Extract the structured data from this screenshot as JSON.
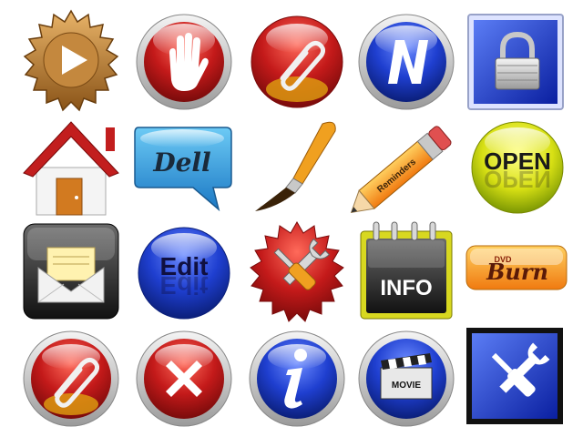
{
  "icons": [
    {
      "name": "play-icon",
      "color": "#b8782e"
    },
    {
      "name": "stop-hand-icon",
      "color": "#c41a1a"
    },
    {
      "name": "paperclip-icon",
      "color": "#c41a1a"
    },
    {
      "name": "n-letter-icon",
      "color": "#1f3fd0"
    },
    {
      "name": "padlock-icon",
      "color": "#1f3fd0"
    },
    {
      "name": "home-icon",
      "color": "#c21e1e"
    },
    {
      "name": "dell-speech-bubble-icon",
      "label": "Dell",
      "color": "#2b93d6"
    },
    {
      "name": "paintbrush-icon",
      "color": "#f0a020"
    },
    {
      "name": "pencil-icon",
      "label": "Reminders",
      "color": "#f2a020"
    },
    {
      "name": "open-orb-icon",
      "label": "OPEN",
      "color": "#d8e014"
    },
    {
      "name": "mail-envelope-icon",
      "color": "#333333"
    },
    {
      "name": "edit-orb-icon",
      "label": "Edit",
      "color": "#1f3fd0"
    },
    {
      "name": "tools-seal-icon",
      "color": "#c41a1a"
    },
    {
      "name": "info-notepad-icon",
      "label": "INFO",
      "color": "#222222"
    },
    {
      "name": "dvd-burn-icon",
      "label_small": "DVD",
      "label": "Burn",
      "color": "#f5a020"
    },
    {
      "name": "paperclip-icon",
      "color": "#c41a1a"
    },
    {
      "name": "close-icon",
      "color": "#c41a1a"
    },
    {
      "name": "info-icon",
      "color": "#1f3fd0"
    },
    {
      "name": "movie-clapper-icon",
      "label": "MOVIE",
      "color": "#1f3fd0"
    },
    {
      "name": "tools-icon",
      "color": "#1f3fd0"
    }
  ]
}
